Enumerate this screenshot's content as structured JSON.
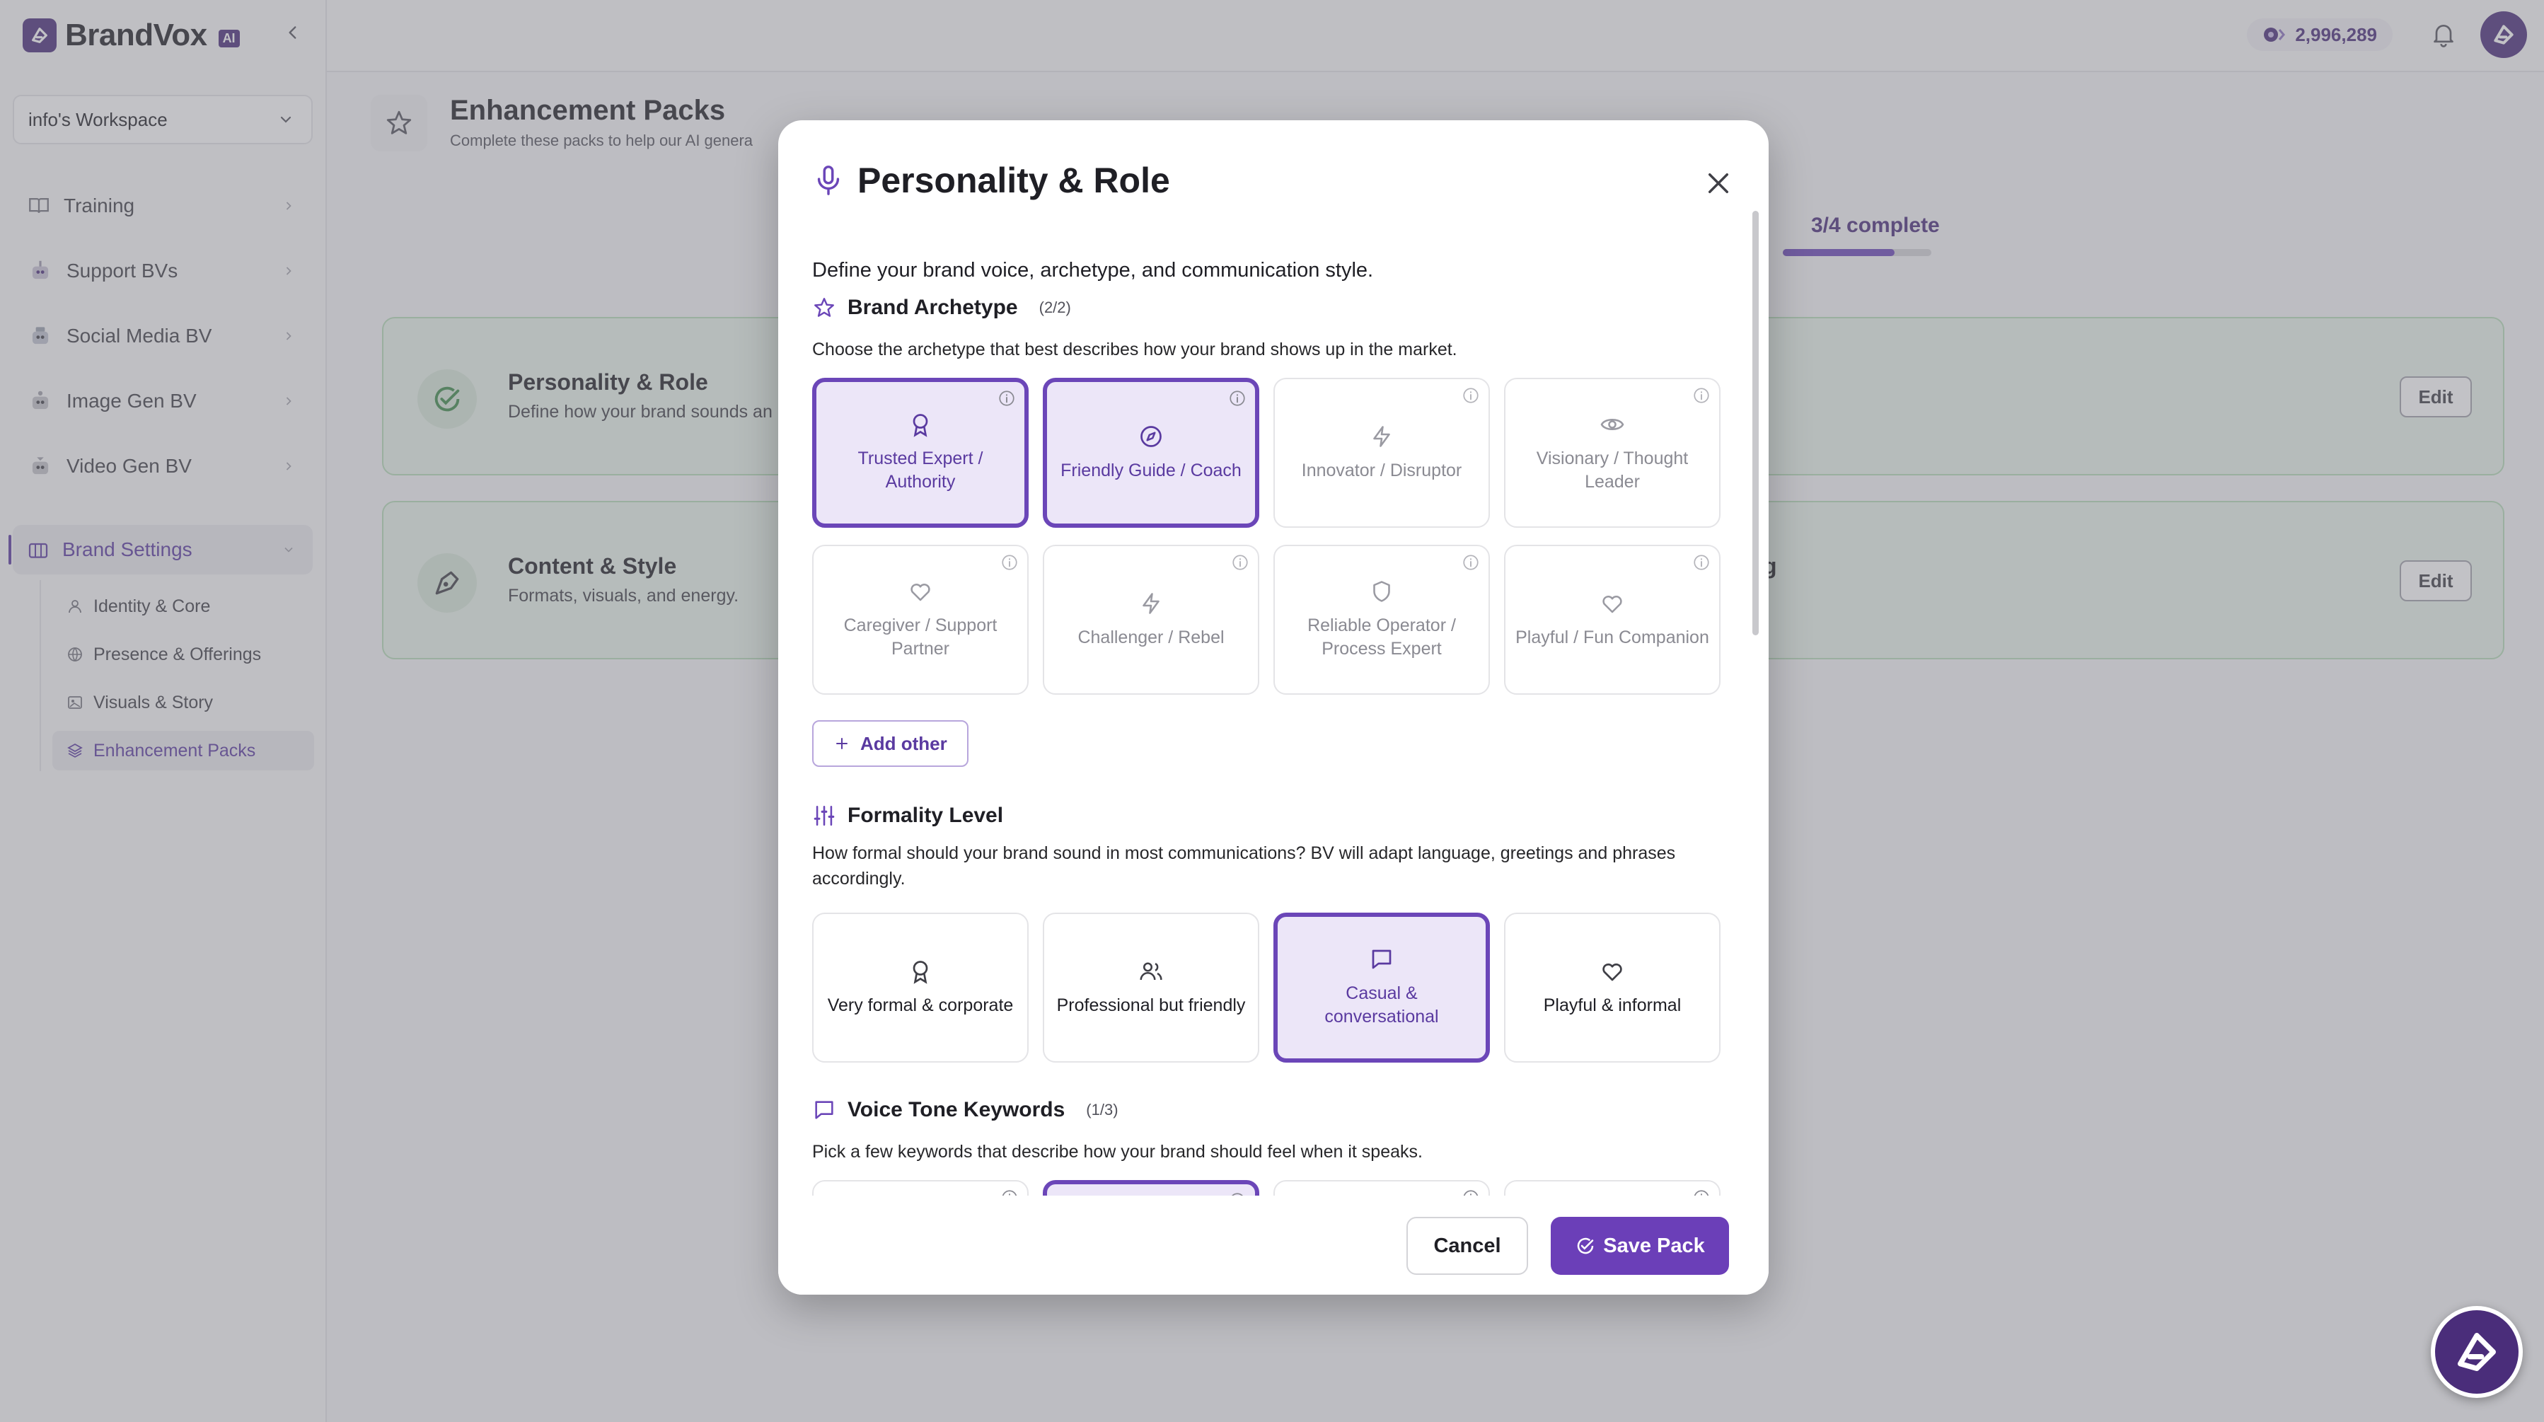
{
  "app": {
    "name": "BrandVox",
    "badge": "AI"
  },
  "colors": {
    "accent": "#6b46b8",
    "accent_dark": "#4a2d7a",
    "success_bg": "#eaf4eb",
    "success_border": "#b6dcb8"
  },
  "sidebar": {
    "workspace": "info's Workspace",
    "items": [
      {
        "label": "Training",
        "icon": "book-icon"
      },
      {
        "label": "Support BVs",
        "icon": "support-bot-icon"
      },
      {
        "label": "Social Media BV",
        "icon": "social-bot-icon"
      },
      {
        "label": "Image Gen BV",
        "icon": "image-bot-icon"
      },
      {
        "label": "Video Gen BV",
        "icon": "video-bot-icon"
      },
      {
        "label": "Brand Settings",
        "icon": "building-icon"
      }
    ],
    "sub_items": [
      {
        "label": "Identity & Core",
        "icon": "user-icon"
      },
      {
        "label": "Presence & Offerings",
        "icon": "globe-icon"
      },
      {
        "label": "Visuals & Story",
        "icon": "image-icon"
      },
      {
        "label": "Enhancement Packs",
        "icon": "layers-icon"
      }
    ]
  },
  "topbar": {
    "credits": "2,996,289"
  },
  "page": {
    "title": "Enhancement Packs",
    "subtitle": "Complete these packs to help our AI genera",
    "progress": "3/4 complete",
    "progress_fraction": 0.75,
    "cards": [
      {
        "title": "Personality & Role",
        "desc": "Define how your brand sounds an",
        "edit": "Edit",
        "tail": ""
      },
      {
        "title": "Content & Style",
        "desc": "Formats, visuals, and energy.",
        "edit": "Edit",
        "tail": "g"
      }
    ]
  },
  "modal": {
    "title": "Personality & Role",
    "description": "Define your brand voice, archetype, and communication style.",
    "archetype": {
      "title": "Brand Archetype",
      "count": "(2/2)",
      "description": "Choose the archetype that best describes how your brand shows up in the market.",
      "options": [
        {
          "label": "Trusted Expert / Authority",
          "icon": "award-icon",
          "selected": true
        },
        {
          "label": "Friendly Guide / Coach",
          "icon": "compass-icon",
          "selected": true
        },
        {
          "label": "Innovator / Disruptor",
          "icon": "lightning-icon",
          "selected": false
        },
        {
          "label": "Visionary / Thought Leader",
          "icon": "eye-icon",
          "selected": false
        },
        {
          "label": "Caregiver / Support Partner",
          "icon": "heart-icon",
          "selected": false
        },
        {
          "label": "Challenger / Rebel",
          "icon": "lightning-icon",
          "selected": false
        },
        {
          "label": "Reliable Operator / Process Expert",
          "icon": "shield-icon",
          "selected": false
        },
        {
          "label": "Playful / Fun Companion",
          "icon": "heart-icon",
          "selected": false
        }
      ],
      "add_other": "Add other"
    },
    "formality": {
      "title": "Formality Level",
      "description": "How formal should your brand sound in most communications? BV will adapt language, greetings and phrases accordingly.",
      "options": [
        {
          "label": "Very formal & corporate",
          "icon": "award-icon",
          "selected": false
        },
        {
          "label": "Professional but friendly",
          "icon": "users-icon",
          "selected": false
        },
        {
          "label": "Casual & conversational",
          "icon": "chat-icon",
          "selected": true
        },
        {
          "label": "Playful & informal",
          "icon": "heart-icon",
          "selected": false
        }
      ]
    },
    "voice": {
      "title": "Voice Tone Keywords",
      "count": "(1/3)",
      "description": "Pick a few keywords that describe how your brand should feel when it speaks."
    },
    "cancel": "Cancel",
    "save": "Save Pack"
  }
}
